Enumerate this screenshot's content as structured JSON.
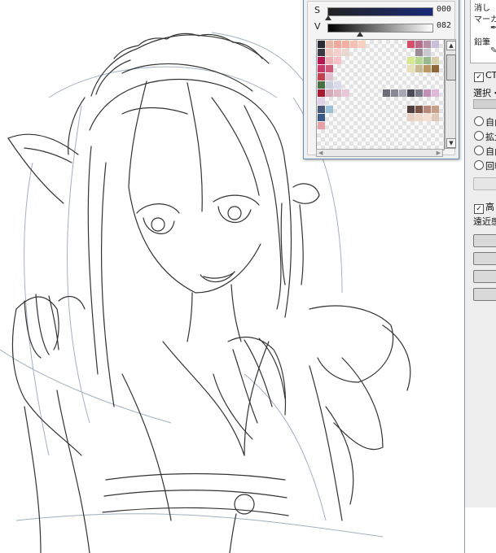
{
  "color_panel": {
    "s_label": "S",
    "s_value": "000",
    "v_label": "V",
    "v_value": "082",
    "s_level": 0.0,
    "v_level": 0.32
  },
  "palette": {
    "rows": [
      [
        "#2a2a33",
        "#e8b6a8",
        "#f0a898",
        "#f4b0a0",
        "#f8c0b0",
        "#f9d0c0",
        "",
        "",
        "",
        "",
        "",
        "#d4506a",
        "#b86a86",
        "#b890a8",
        "#c8c0d8"
      ],
      [
        "#3a3a44",
        "#f0c8c0",
        "#f4d0c8",
        "#ead8d0",
        "",
        "",
        "",
        "",
        "",
        "",
        "",
        "",
        "#9c8c98",
        "#c8c8d0",
        ""
      ],
      [
        "#b81850",
        "#f0b0b8",
        "#f8c0c8",
        "",
        "",
        "",
        "",
        "",
        "",
        "",
        "",
        "#d8e890",
        "#b8d890",
        "#98b890",
        "#d8d0a8"
      ],
      [
        "#c83868",
        "#d05878",
        "",
        "",
        "",
        "",
        "",
        "",
        "",
        "",
        "",
        "#e8e0b8",
        "#c8b890",
        "#b89860",
        "#8c6838"
      ],
      [
        "#c04050",
        "#e0c0d0",
        "",
        "",
        "",
        "",
        "",
        "",
        "",
        "",
        "",
        "",
        "",
        "",
        ""
      ],
      [
        "#487040",
        "#c8d0e0",
        "#d8dcec",
        "",
        "",
        "",
        "",
        "",
        "",
        "",
        "",
        "",
        "",
        "",
        ""
      ],
      [
        "#a81830",
        "#d8a8b8",
        "#e0b8c8",
        "#e8c8d8",
        "",
        "",
        "",
        "",
        "#6c6c78",
        "#888894",
        "#a8a8b4",
        "#4c4c58",
        "#7c7c88",
        "#c090b8",
        "#e0b8d8"
      ],
      [
        "#e0d0e8",
        "",
        "",
        "",
        "",
        "",
        "",
        "",
        "",
        "",
        "",
        "",
        "",
        "",
        ""
      ],
      [
        "#485878",
        "#9cc0d8",
        "",
        "",
        "",
        "",
        "",
        "",
        "",
        "",
        "",
        "#503c3c",
        "#7c5448",
        "#b88878",
        "#c8a088"
      ],
      [
        "#385888",
        "",
        "",
        "",
        "",
        "",
        "",
        "",
        "",
        "",
        "",
        "#e8d0c0",
        "#f0d8c8",
        "#f8e0d0",
        "#e0c8b8"
      ],
      [
        "#e8a0a8",
        "",
        "",
        "",
        "",
        "",
        "",
        "",
        "",
        "",
        "",
        "",
        "",
        "",
        ""
      ]
    ]
  },
  "tool_panel": {
    "tool_1_label": "消し",
    "tool_2_label": "マーカー",
    "tool_3_label": "鉛筆",
    "pen_icon": "pen-icon",
    "ct_label": "CT",
    "ct_checked": "✓",
    "selection_label": "選択・",
    "radio_1": "自由",
    "radio_2": "拡大",
    "radio_3": "自由",
    "radio_4": "回転",
    "high_label": "高",
    "high_checked": "✓",
    "perspective_label": "遠近感"
  },
  "colors": {
    "panel_bg": "#f0f0f0",
    "window_border": "#6b8bb3",
    "line_art": "#333333",
    "guide_line": "#9aa8b8"
  }
}
